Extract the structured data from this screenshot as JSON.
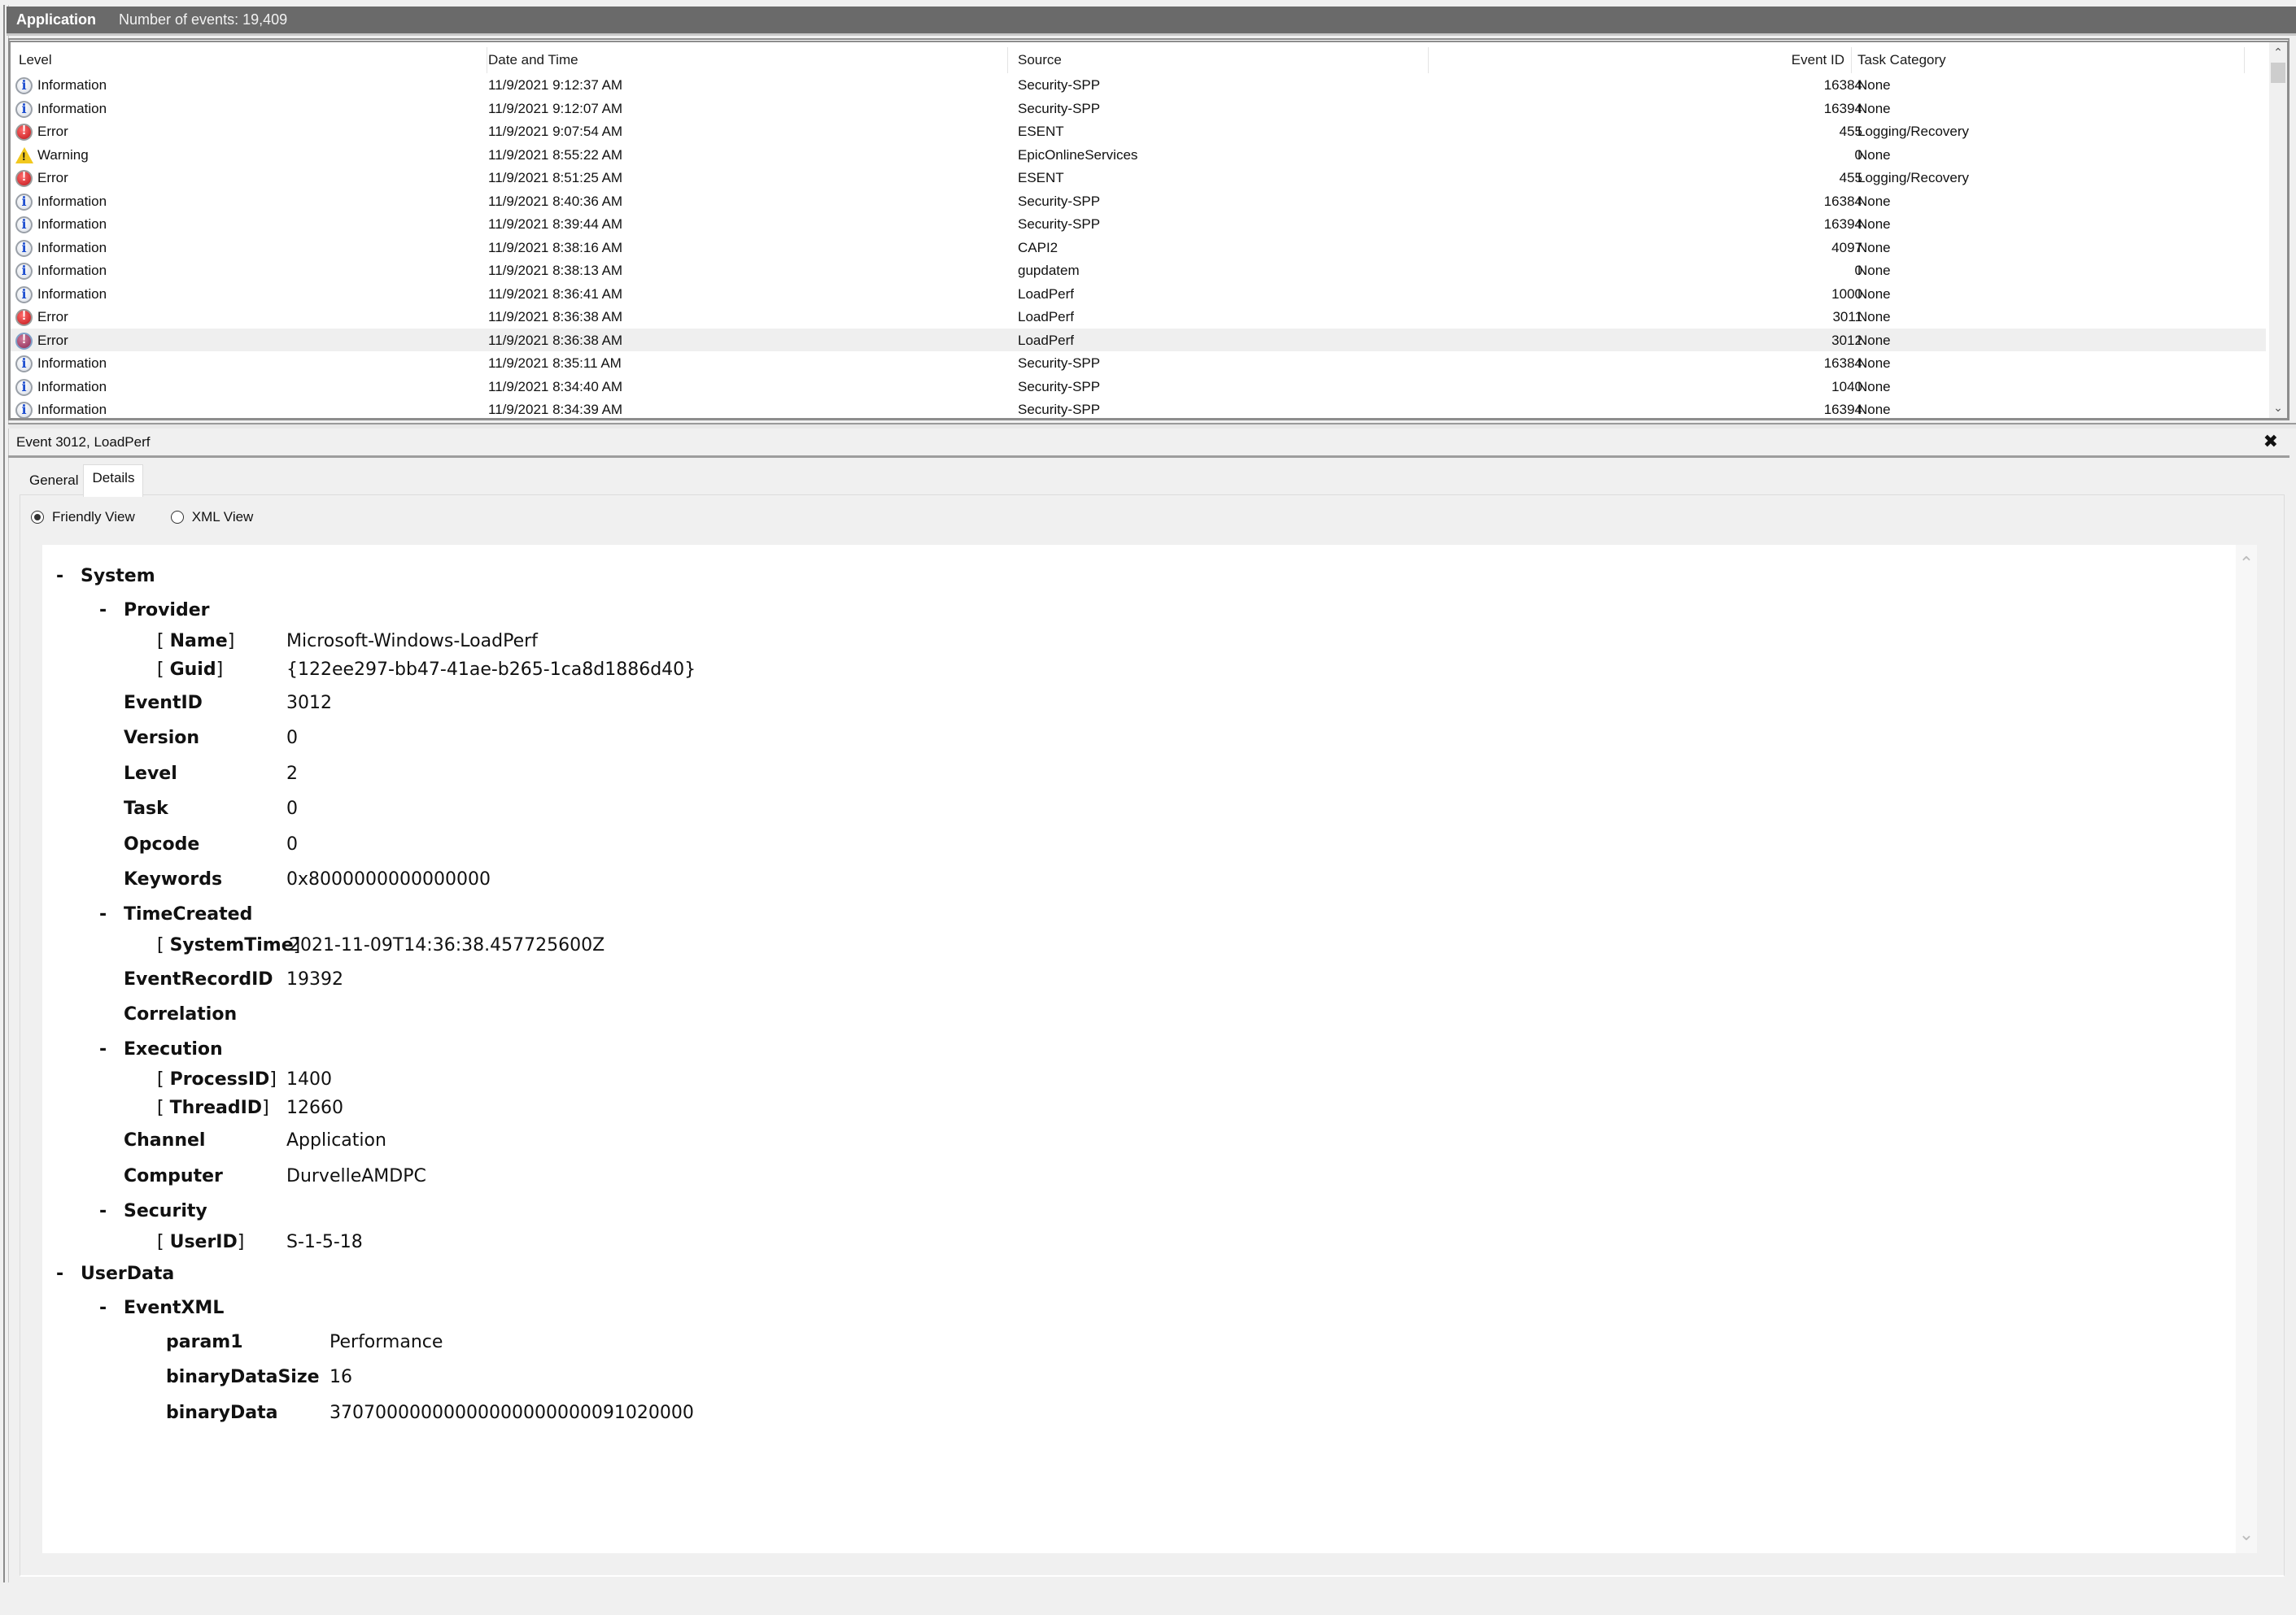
{
  "titlebar": {
    "log_name": "Application",
    "event_count_text": "Number of events: 19,409"
  },
  "list": {
    "columns": {
      "level": "Level",
      "date_time": "Date and Time",
      "source": "Source",
      "event_id": "Event ID",
      "task_category": "Task Category"
    },
    "rows": [
      {
        "level": "Information",
        "icon": "info-icon",
        "date": "11/9/2021 9:12:37 AM",
        "source": "Security-SPP",
        "event_id": "16384",
        "task": "None"
      },
      {
        "level": "Information",
        "icon": "info-icon",
        "date": "11/9/2021 9:12:07 AM",
        "source": "Security-SPP",
        "event_id": "16394",
        "task": "None"
      },
      {
        "level": "Error",
        "icon": "error-icon",
        "date": "11/9/2021 9:07:54 AM",
        "source": "ESENT",
        "event_id": "455",
        "task": "Logging/Recovery"
      },
      {
        "level": "Warning",
        "icon": "warning-icon",
        "date": "11/9/2021 8:55:22 AM",
        "source": "EpicOnlineServices",
        "event_id": "0",
        "task": "None"
      },
      {
        "level": "Error",
        "icon": "error-icon",
        "date": "11/9/2021 8:51:25 AM",
        "source": "ESENT",
        "event_id": "455",
        "task": "Logging/Recovery"
      },
      {
        "level": "Information",
        "icon": "info-icon",
        "date": "11/9/2021 8:40:36 AM",
        "source": "Security-SPP",
        "event_id": "16384",
        "task": "None"
      },
      {
        "level": "Information",
        "icon": "info-icon",
        "date": "11/9/2021 8:39:44 AM",
        "source": "Security-SPP",
        "event_id": "16394",
        "task": "None"
      },
      {
        "level": "Information",
        "icon": "info-icon",
        "date": "11/9/2021 8:38:16 AM",
        "source": "CAPI2",
        "event_id": "4097",
        "task": "None"
      },
      {
        "level": "Information",
        "icon": "info-icon",
        "date": "11/9/2021 8:38:13 AM",
        "source": "gupdatem",
        "event_id": "0",
        "task": "None"
      },
      {
        "level": "Information",
        "icon": "info-icon",
        "date": "11/9/2021 8:36:41 AM",
        "source": "LoadPerf",
        "event_id": "1000",
        "task": "None"
      },
      {
        "level": "Error",
        "icon": "error-icon",
        "date": "11/9/2021 8:36:38 AM",
        "source": "LoadPerf",
        "event_id": "3011",
        "task": "None"
      },
      {
        "level": "Error",
        "icon": "error-icon",
        "date": "11/9/2021 8:36:38 AM",
        "source": "LoadPerf",
        "event_id": "3012",
        "task": "None",
        "selected": true
      },
      {
        "level": "Information",
        "icon": "info-icon",
        "date": "11/9/2021 8:35:11 AM",
        "source": "Security-SPP",
        "event_id": "16384",
        "task": "None"
      },
      {
        "level": "Information",
        "icon": "info-icon",
        "date": "11/9/2021 8:34:40 AM",
        "source": "Security-SPP",
        "event_id": "1040",
        "task": "None"
      },
      {
        "level": "Information",
        "icon": "info-icon",
        "date": "11/9/2021 8:34:39 AM",
        "source": "Security-SPP",
        "event_id": "16394",
        "task": "None"
      }
    ]
  },
  "detail": {
    "title": "Event 3012, LoadPerf",
    "close_icon": "close-icon",
    "tabs": [
      {
        "label": "General",
        "active": false
      },
      {
        "label": "Details",
        "active": true
      }
    ],
    "views": [
      {
        "label": "Friendly View",
        "selected": true
      },
      {
        "label": "XML View",
        "selected": false
      }
    ],
    "tree": {
      "system": "System",
      "provider": "Provider",
      "provider_name_key": "Name",
      "provider_name_val": "Microsoft-Windows-LoadPerf",
      "provider_guid_key": "Guid",
      "provider_guid_val": "{122ee297-bb47-41ae-b265-1ca8d1886d40}",
      "eventid_key": "EventID",
      "eventid_val": "3012",
      "version_key": "Version",
      "version_val": "0",
      "level_key": "Level",
      "level_val": "2",
      "task_key": "Task",
      "task_val": "0",
      "opcode_key": "Opcode",
      "opcode_val": "0",
      "keywords_key": "Keywords",
      "keywords_val": "0x8000000000000000",
      "timecreated": "TimeCreated",
      "systemtime_key": "SystemTime",
      "systemtime_val": "2021-11-09T14:36:38.457725600Z",
      "recordid_key": "EventRecordID",
      "recordid_val": "19392",
      "correlation_key": "Correlation",
      "execution": "Execution",
      "processid_key": "ProcessID",
      "processid_val": "1400",
      "threadid_key": "ThreadID",
      "threadid_val": "12660",
      "channel_key": "Channel",
      "channel_val": "Application",
      "computer_key": "Computer",
      "computer_val": "DurvelleAMDPC",
      "security": "Security",
      "userid_key": "UserID",
      "userid_val": "S-1-5-18",
      "userdata": "UserData",
      "eventxml": "EventXML",
      "param1_key": "param1",
      "param1_val": "Performance",
      "bds_key": "binaryDataSize",
      "bds_val": "16",
      "bd_key": "binaryData",
      "bd_val": "37070000000000000000000091020000"
    }
  }
}
